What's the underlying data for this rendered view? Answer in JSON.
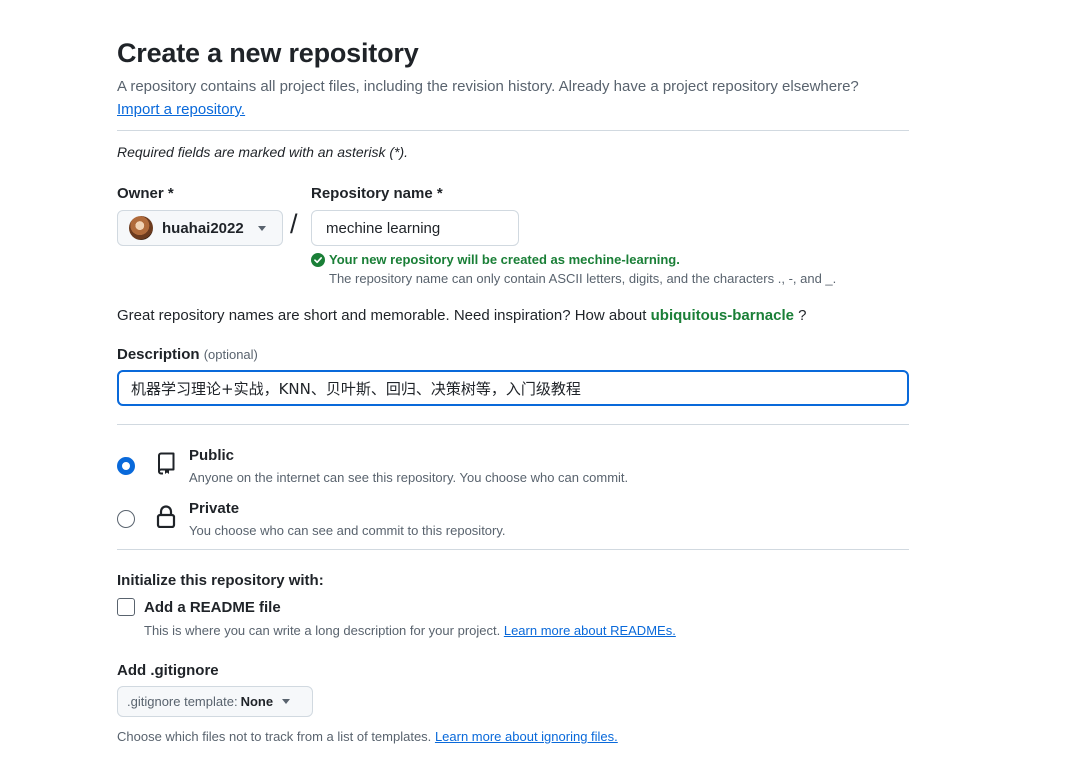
{
  "header": {
    "title": "Create a new repository",
    "subtitle": "A repository contains all project files, including the revision history. Already have a project repository elsewhere?",
    "import_link": "Import a repository."
  },
  "form": {
    "required_note": "Required fields are marked with an asterisk (*).",
    "owner": {
      "label": "Owner *",
      "value": "huahai2022"
    },
    "slash": "/",
    "repo_name": {
      "label": "Repository name *",
      "value": "mechine learning",
      "valid_message": "Your new repository will be created as mechine-learning.",
      "rule": "The repository name can only contain ASCII letters, digits, and the characters ., -, and _."
    },
    "inspiration": {
      "text": "Great repository names are short and memorable. Need inspiration? How about",
      "suggestion": "ubiquitous-barnacle",
      "end": "?"
    },
    "description": {
      "label": "Description",
      "optional": "(optional)",
      "value": "机器学习理论+实战，KNN、贝叶斯、回归、决策树等，入门级教程"
    },
    "visibility": {
      "selected": "public",
      "options": [
        {
          "id": "public",
          "icon": "repo-icon",
          "title": "Public",
          "description": "Anyone on the internet can see this repository. You choose who can commit."
        },
        {
          "id": "private",
          "icon": "lock-icon",
          "title": "Private",
          "description": "You choose who can see and commit to this repository."
        }
      ]
    },
    "initialize": {
      "title": "Initialize this repository with:",
      "readme_label": "Add a README file",
      "readme_checked": false,
      "readme_desc": "This is where you can write a long description for your project.",
      "readme_link": "Learn more about READMEs."
    },
    "gitignore": {
      "title": "Add .gitignore",
      "prefix": ".gitignore template:",
      "value": "None",
      "desc": "Choose which files not to track from a list of templates.",
      "link": "Learn more about ignoring files."
    }
  },
  "colors": {
    "accent": "#0969da",
    "success": "#1a7f37",
    "muted": "#59636e",
    "border": "#d1d9e0"
  }
}
